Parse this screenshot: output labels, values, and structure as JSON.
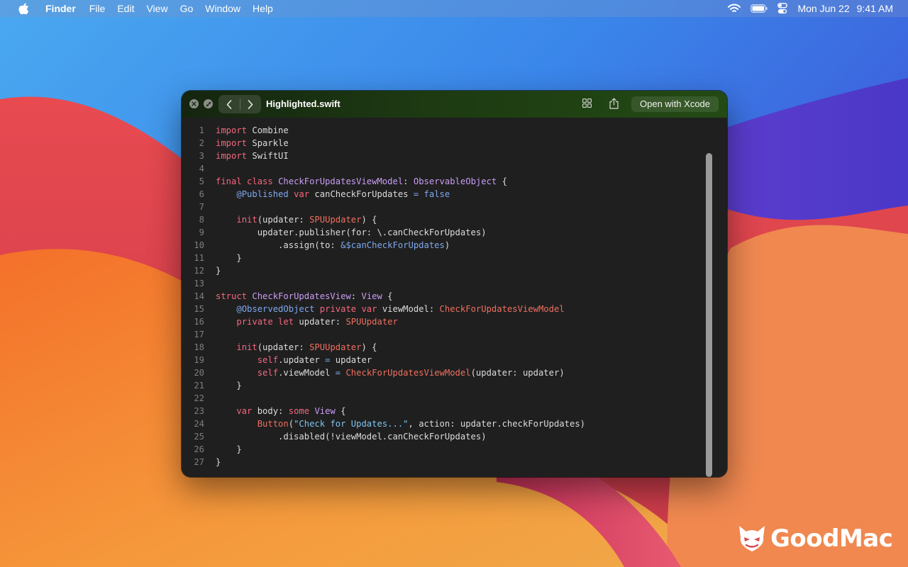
{
  "menubar": {
    "app_name": "Finder",
    "menus": [
      "File",
      "Edit",
      "View",
      "Go",
      "Window",
      "Help"
    ],
    "status_icons": [
      "wifi-icon",
      "battery-icon",
      "control-center-icon"
    ],
    "date": "Mon Jun 22",
    "time": "9:41 AM"
  },
  "window": {
    "title": "Highlighted.swift",
    "open_button_label": "Open with Xcode",
    "toolbar_icons": [
      "close-icon",
      "fullscreen-icon",
      "chevron-left-icon",
      "chevron-right-icon",
      "grid-icon",
      "share-icon"
    ]
  },
  "code": {
    "language": "swift",
    "lines": [
      [
        [
          "kw",
          "import"
        ],
        [
          "plain",
          " Combine"
        ]
      ],
      [
        [
          "kw",
          "import"
        ],
        [
          "plain",
          " Sparkle"
        ]
      ],
      [
        [
          "kw",
          "import"
        ],
        [
          "plain",
          " SwiftUI"
        ]
      ],
      [],
      [
        [
          "kw",
          "final class"
        ],
        [
          "plain",
          " "
        ],
        [
          "type",
          "CheckForUpdatesViewModel"
        ],
        [
          "plain",
          ": "
        ],
        [
          "type",
          "ObservableObject"
        ],
        [
          "plain",
          " {"
        ]
      ],
      [
        [
          "plain",
          "    "
        ],
        [
          "attr",
          "@Published"
        ],
        [
          "plain",
          " "
        ],
        [
          "kw",
          "var"
        ],
        [
          "plain",
          " canCheckForUpdates "
        ],
        [
          "lit",
          "="
        ],
        [
          "plain",
          " "
        ],
        [
          "lit",
          "false"
        ]
      ],
      [],
      [
        [
          "plain",
          "    "
        ],
        [
          "kw",
          "init"
        ],
        [
          "plain",
          "(updater: "
        ],
        [
          "cls",
          "SPUUpdater"
        ],
        [
          "plain",
          ") {"
        ]
      ],
      [
        [
          "plain",
          "        updater.publisher(for: \\.canCheckForUpdates)"
        ]
      ],
      [
        [
          "plain",
          "            .assign(to: "
        ],
        [
          "lit",
          "&$canCheckForUpdates"
        ],
        [
          "plain",
          ")"
        ]
      ],
      [
        [
          "plain",
          "    }"
        ]
      ],
      [
        [
          "plain",
          "}"
        ]
      ],
      [],
      [
        [
          "kw",
          "struct"
        ],
        [
          "plain",
          " "
        ],
        [
          "type",
          "CheckForUpdatesView"
        ],
        [
          "plain",
          ": "
        ],
        [
          "type",
          "View"
        ],
        [
          "plain",
          " {"
        ]
      ],
      [
        [
          "plain",
          "    "
        ],
        [
          "attr",
          "@ObservedObject"
        ],
        [
          "plain",
          " "
        ],
        [
          "kw",
          "private var"
        ],
        [
          "plain",
          " viewModel: "
        ],
        [
          "cls",
          "CheckForUpdatesViewModel"
        ]
      ],
      [
        [
          "plain",
          "    "
        ],
        [
          "kw",
          "private let"
        ],
        [
          "plain",
          " updater: "
        ],
        [
          "cls",
          "SPUUpdater"
        ]
      ],
      [],
      [
        [
          "plain",
          "    "
        ],
        [
          "kw",
          "init"
        ],
        [
          "plain",
          "(updater: "
        ],
        [
          "cls",
          "SPUUpdater"
        ],
        [
          "plain",
          ") {"
        ]
      ],
      [
        [
          "plain",
          "        "
        ],
        [
          "kw",
          "self"
        ],
        [
          "plain",
          ".updater "
        ],
        [
          "lit",
          "="
        ],
        [
          "plain",
          " updater"
        ]
      ],
      [
        [
          "plain",
          "        "
        ],
        [
          "kw",
          "self"
        ],
        [
          "plain",
          ".viewModel "
        ],
        [
          "lit",
          "="
        ],
        [
          "plain",
          " "
        ],
        [
          "cls",
          "CheckForUpdatesViewModel"
        ],
        [
          "plain",
          "(updater: updater)"
        ]
      ],
      [
        [
          "plain",
          "    }"
        ]
      ],
      [],
      [
        [
          "plain",
          "    "
        ],
        [
          "kw",
          "var"
        ],
        [
          "plain",
          " body: "
        ],
        [
          "kw",
          "some"
        ],
        [
          "plain",
          " "
        ],
        [
          "type",
          "View"
        ],
        [
          "plain",
          " {"
        ]
      ],
      [
        [
          "plain",
          "        "
        ],
        [
          "cls",
          "Button"
        ],
        [
          "plain",
          "("
        ],
        [
          "str",
          "\"Check for Updates...\""
        ],
        [
          "plain",
          ", action: updater.checkForUpdates)"
        ]
      ],
      [
        [
          "plain",
          "            .disabled(!viewModel.canCheckForUpdates)"
        ]
      ],
      [
        [
          "plain",
          "    }"
        ]
      ],
      [
        [
          "plain",
          "}"
        ]
      ]
    ]
  },
  "watermark": {
    "brand": "GoodMac"
  },
  "colors": {
    "keyword": "#f5677f",
    "type": "#c99df4",
    "attribute": "#7ea8ef",
    "string": "#7ec4ef",
    "class_ref": "#ef6f5f",
    "code_background": "#1f1f1f"
  }
}
